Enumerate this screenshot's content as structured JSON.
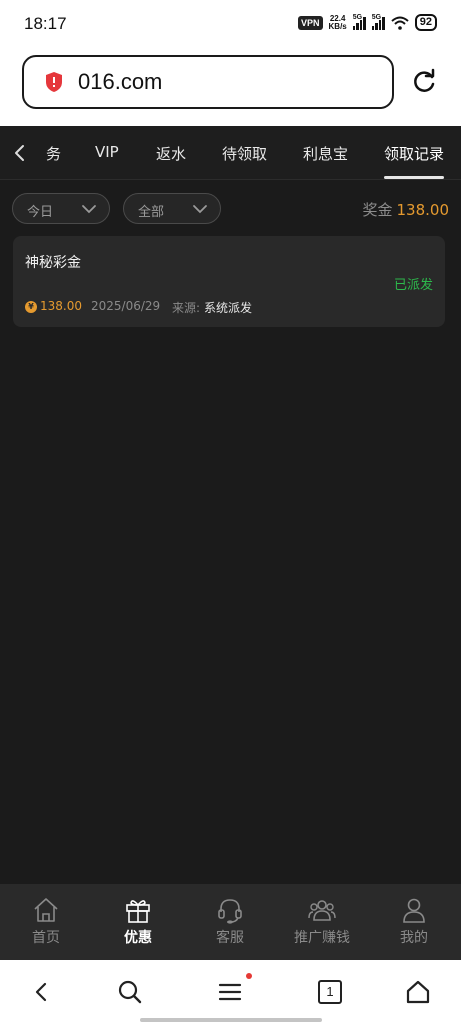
{
  "status_bar": {
    "time": "18:17",
    "vpn": "VPN",
    "speed_value": "22.4",
    "speed_unit": "KB/s",
    "signal1": "5G",
    "signal2": "5G",
    "battery": "92"
  },
  "browser": {
    "url": "016.com"
  },
  "tabs": [
    {
      "label": "务"
    },
    {
      "label": "VIP"
    },
    {
      "label": "返水"
    },
    {
      "label": "待领取"
    },
    {
      "label": "利息宝"
    },
    {
      "label": "领取记录",
      "active": true
    }
  ],
  "filters": {
    "date": "今日",
    "type": "全部"
  },
  "bonus": {
    "label": "奖金",
    "value": "138.00"
  },
  "records": [
    {
      "title": "神秘彩金",
      "status": "已派发",
      "coin": "¥",
      "amount": "138.00",
      "date": "2025/06/29",
      "source_label": "来源:",
      "source": "系统派发"
    }
  ],
  "bottom_nav": [
    {
      "label": "首页",
      "icon": "home-icon"
    },
    {
      "label": "优惠",
      "icon": "gift-icon",
      "active": true
    },
    {
      "label": "客服",
      "icon": "headset-icon"
    },
    {
      "label": "推广赚钱",
      "icon": "users-icon"
    },
    {
      "label": "我的",
      "icon": "user-icon"
    }
  ],
  "tab_count": "1",
  "colors": {
    "accent": "#e59a2f",
    "success": "#2db84c",
    "background": "#1b1b1b",
    "card": "#292929"
  }
}
